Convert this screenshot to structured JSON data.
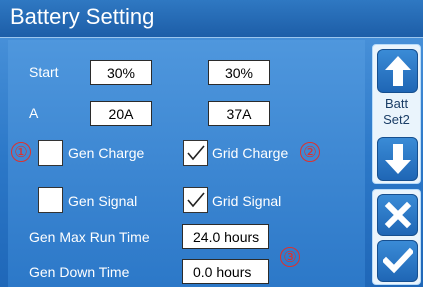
{
  "header": {
    "title": "Battery Setting"
  },
  "rows": {
    "start": {
      "label": "Start",
      "value1": "30%",
      "value2": "30%"
    },
    "amps": {
      "label": "A",
      "value1": "20A",
      "value2": "37A"
    }
  },
  "checks": {
    "gen_charge": {
      "label": "Gen Charge",
      "checked": false
    },
    "grid_charge": {
      "label": "Grid Charge",
      "checked": true
    },
    "gen_signal": {
      "label": "Gen Signal",
      "checked": false
    },
    "grid_signal": {
      "label": "Grid Signal",
      "checked": true
    }
  },
  "gen": {
    "max_run_label": "Gen Max Run Time",
    "max_run_value": "24.0 hours",
    "down_label": "Gen Down Time",
    "down_value": "0.0 hours"
  },
  "annotations": {
    "n1": "①",
    "n2": "②",
    "n3": "③"
  },
  "sidebar": {
    "batt_label_line1": "Batt",
    "batt_label_line2": "Set2",
    "up_icon": "arrow-up-icon",
    "down_icon": "arrow-down-icon",
    "cancel_icon": "close-icon",
    "confirm_icon": "check-icon"
  },
  "colors": {
    "accent": "#2c78c8",
    "annotation": "#e0302b"
  }
}
